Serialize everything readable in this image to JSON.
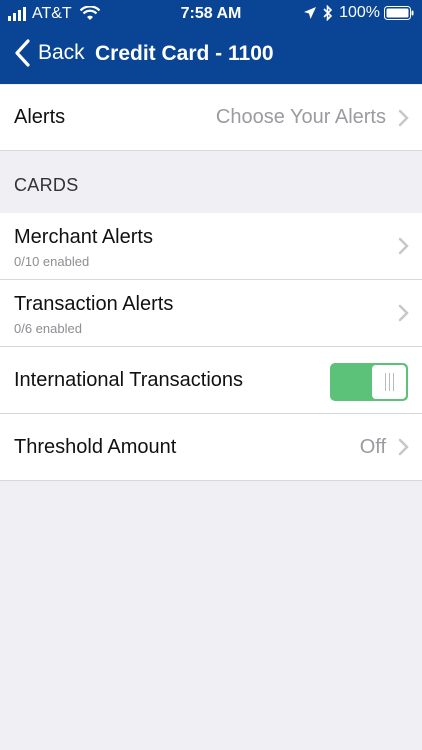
{
  "status_bar": {
    "carrier": "AT&T",
    "time": "7:58 AM",
    "battery": "100%",
    "icons": [
      "signal-bars-icon",
      "wifi-icon",
      "location-arrow-icon",
      "bluetooth-icon",
      "battery-icon"
    ]
  },
  "nav": {
    "back_label": "Back",
    "title": "Credit Card - 1100"
  },
  "alerts_row": {
    "label": "Alerts",
    "value": "Choose Your Alerts"
  },
  "section": {
    "header": "CARDS"
  },
  "rows": {
    "merchant": {
      "label": "Merchant Alerts",
      "sub": "0/10 enabled"
    },
    "transaction": {
      "label": "Transaction Alerts",
      "sub": "0/6 enabled"
    },
    "international": {
      "label": "International Transactions",
      "toggle_on": true
    },
    "threshold": {
      "label": "Threshold Amount",
      "value": "Off"
    }
  },
  "colors": {
    "nav_background": "#0a4595",
    "toggle_on": "#5cc27a",
    "page_background": "#efeff4"
  }
}
